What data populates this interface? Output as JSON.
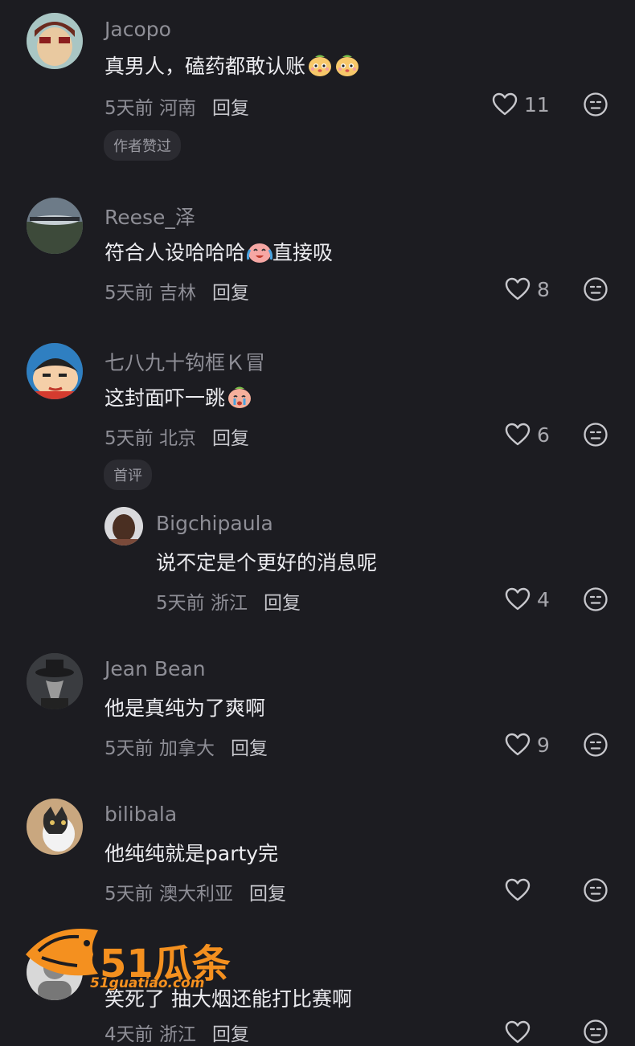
{
  "comments": [
    {
      "user": "Jacopo",
      "text": "真男人，磕药都敢认账",
      "emoji_count": 2,
      "time": "5天前",
      "location": "河南",
      "reply": "回复",
      "likes": "11",
      "tag": "作者赞过"
    },
    {
      "user": "Reese_泽",
      "text_before": "符合人设哈哈哈",
      "text_after": "直接吸",
      "time": "5天前",
      "location": "吉林",
      "reply": "回复",
      "likes": "8"
    },
    {
      "user": "七八九十钩框Ｋ冒",
      "text": "这封面吓一跳",
      "time": "5天前",
      "location": "北京",
      "reply": "回复",
      "likes": "6",
      "tag": "首评"
    },
    {
      "user": "Bigchipaula",
      "text": "说不定是个更好的消息呢",
      "time": "5天前",
      "location": "浙江",
      "reply": "回复",
      "likes": "4"
    },
    {
      "user": "Jean Bean",
      "text": "他是真纯为了爽啊",
      "time": "5天前",
      "location": "加拿大",
      "reply": "回复",
      "likes": "9"
    },
    {
      "user": "bilibala",
      "text": "他纯纯就是party完",
      "time": "5天前",
      "location": "澳大利亚",
      "reply": "回复",
      "likes": ""
    },
    {
      "user": "",
      "text": "笑死了 抽大烟还能打比赛啊",
      "time": "4天前",
      "location": "浙江",
      "reply": "回复",
      "likes": ""
    }
  ],
  "watermark": {
    "title": "51瓜条",
    "number": "51",
    "url": "51guatiao.com"
  },
  "icons": {
    "like": "heart-outline-icon",
    "react": "neutral-face-icon"
  },
  "colors": {
    "background": "#1c1c21",
    "text": "#ececf0",
    "muted": "#8e8e96",
    "brand": "#f4901f"
  }
}
